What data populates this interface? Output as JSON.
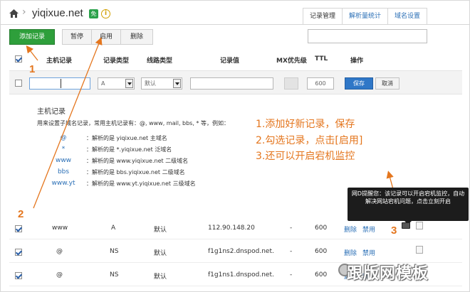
{
  "header": {
    "domain": "yiqixue.net",
    "free_badge": "免",
    "info_icon": "i"
  },
  "tabs": [
    {
      "label": "记录管理",
      "active": true
    },
    {
      "label": "解析量统计",
      "active": false
    },
    {
      "label": "域名设置",
      "active": false
    }
  ],
  "toolbar": {
    "add": "添加记录",
    "pause": "暂停",
    "enable": "启用",
    "delete": "删除"
  },
  "table": {
    "headers": {
      "host": "主机记录",
      "type": "记录类型",
      "line": "线路类型",
      "value": "记录值",
      "mx": "MX优先级",
      "ttl": "TTL",
      "action": "操作"
    }
  },
  "editor": {
    "host": "",
    "type": "A",
    "line": "默认",
    "value": "",
    "ttl": "600",
    "save": "保存",
    "cancel": "取消"
  },
  "help": {
    "title": "主机记录",
    "desc": "用来设置子域名记录，常用主机记录有：@, www, mail, bbs, * 等，例如：",
    "examples": [
      {
        "key": "@",
        "text": "：解析的是 yiqixue.net 主域名"
      },
      {
        "key": "*",
        "text": "：解析的是 *.yiqixue.net 泛域名"
      },
      {
        "key": "www",
        "text": "：解析的是 www.yiqixue.net 二级域名"
      },
      {
        "key": "bbs",
        "text": "：解析的是 bbs.yiqixue.net 二级域名"
      },
      {
        "key": "www.yt",
        "text": "：解析的是 www.yt.yiqixue.net 三级域名"
      }
    ]
  },
  "annotations": {
    "line1": "1.添加好新记录，保存",
    "line2": "2.勾选记录，点击[启用]",
    "line3": "3.还可以开启宕机监控",
    "n1": "1",
    "n2": "2",
    "n3": "3"
  },
  "tooltip": "网D提醒您：该记录可以开启宕机监控，自动解决网站宕机问题，点击立刻开启",
  "rows": [
    {
      "host": "www",
      "type": "A",
      "line": "默认",
      "value": "112.90.148.20",
      "mx": "-",
      "ttl": "600",
      "del": "删除",
      "pause": "禁用"
    },
    {
      "host": "@",
      "type": "NS",
      "line": "默认",
      "value": "f1g1ns2.dnspod.net.",
      "mx": "-",
      "ttl": "600",
      "del": "删除",
      "pause": "禁用"
    },
    {
      "host": "@",
      "type": "NS",
      "line": "默认",
      "value": "f1g1ns1.dnspod.net.",
      "mx": "-",
      "ttl": "600",
      "del": "删除",
      "pause": "禁用"
    }
  ],
  "watermark": "跟版网模板",
  "colors": {
    "accent_orange": "#e4761e",
    "add_green": "#2e9f3b",
    "save_blue": "#2f77c7",
    "link_blue": "#2a6fb6"
  }
}
